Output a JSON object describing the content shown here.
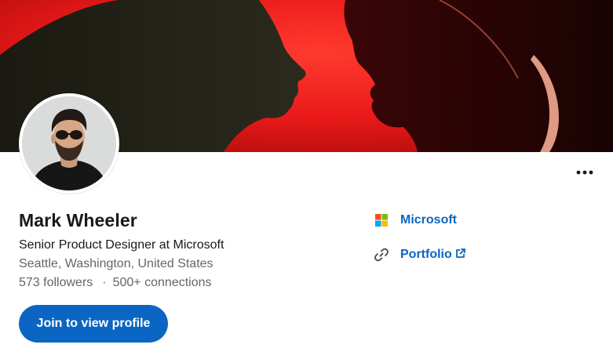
{
  "profile": {
    "name": "Mark Wheeler",
    "headline": "Senior Product Designer at Microsoft",
    "location": "Seattle, Washington, United States",
    "followers": "573 followers",
    "separator": "·",
    "connections": "500+ connections"
  },
  "actions": {
    "join_label": "Join to view profile",
    "more_icon": "more-horizontal-icon"
  },
  "sidebar": {
    "company": {
      "label": "Microsoft",
      "icon": "microsoft-logo-icon"
    },
    "portfolio": {
      "label": "Portfolio",
      "icon": "link-icon",
      "external_icon": "external-link-icon"
    }
  },
  "colors": {
    "brand_blue": "#0a66c2",
    "cover_red": "#ef1d1d",
    "text_primary": "#191919",
    "text_secondary": "#666666"
  }
}
